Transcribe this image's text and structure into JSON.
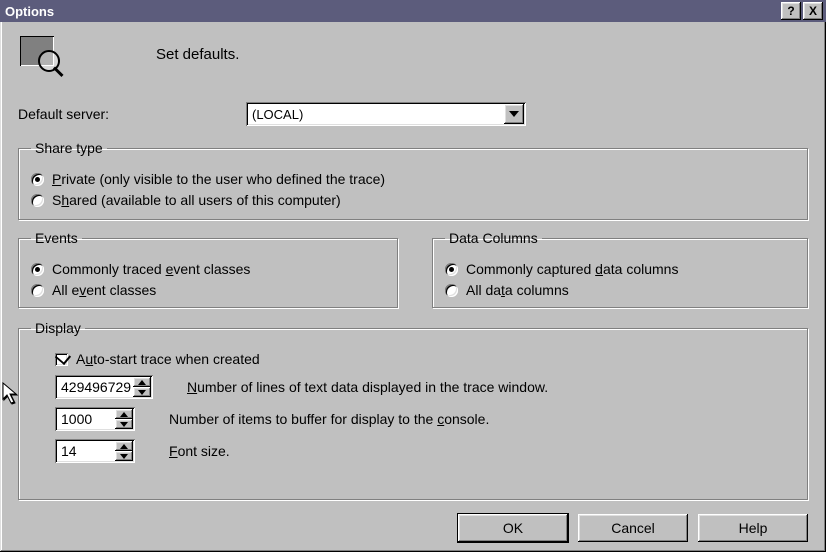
{
  "window": {
    "title": "Options",
    "help_glyph": "?",
    "close_glyph": "X"
  },
  "header": {
    "text": "Set defaults."
  },
  "default_server": {
    "label": "Default server:",
    "value": "(LOCAL)"
  },
  "share_type": {
    "legend": "Share type",
    "options": [
      {
        "label_pre": "",
        "accel": "P",
        "label_post": "rivate (only visible to the user who defined the trace)",
        "checked": true
      },
      {
        "label_pre": "S",
        "accel": "h",
        "label_post": "ared (available to all users of this computer)",
        "checked": false
      }
    ]
  },
  "events": {
    "legend": "Events",
    "options": [
      {
        "label_pre": "Commonly traced ",
        "accel": "e",
        "label_post": "vent classes",
        "checked": true
      },
      {
        "label_pre": "All e",
        "accel": "v",
        "label_post": "ent classes",
        "checked": false
      }
    ]
  },
  "data_columns": {
    "legend": "Data Columns",
    "options": [
      {
        "label_pre": "Commonly captured ",
        "accel": "d",
        "label_post": "ata columns",
        "checked": true
      },
      {
        "label_pre": "All da",
        "accel": "t",
        "label_post": "a columns",
        "checked": false
      }
    ]
  },
  "display": {
    "legend": "Display",
    "auto_start": {
      "label_pre": "A",
      "accel": "u",
      "label_post": "to-start trace when created",
      "checked": true
    },
    "rows": [
      {
        "value": "429496729",
        "label_pre": "",
        "accel": "N",
        "label_post": "umber of lines of text data displayed in the trace window."
      },
      {
        "value": "1000",
        "label_pre": "Number of items to buffer for display to the ",
        "accel": "c",
        "label_post": "onsole."
      },
      {
        "value": "14",
        "label_pre": "",
        "accel": "F",
        "label_post": "ont size."
      }
    ]
  },
  "buttons": {
    "ok": "OK",
    "cancel": "Cancel",
    "help": "Help"
  }
}
